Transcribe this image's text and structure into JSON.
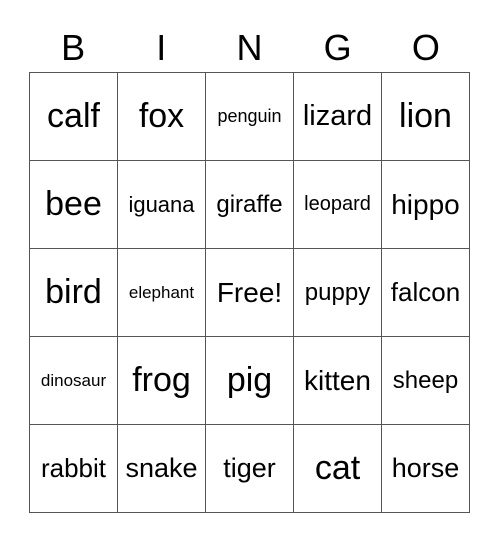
{
  "header": [
    "B",
    "I",
    "N",
    "G",
    "O"
  ],
  "cells": [
    [
      "calf",
      "fox",
      "penguin",
      "lizard",
      "lion"
    ],
    [
      "bee",
      "iguana",
      "giraffe",
      "leopard",
      "hippo"
    ],
    [
      "bird",
      "elephant",
      "Free!",
      "puppy",
      "falcon"
    ],
    [
      "dinosaur",
      "frog",
      "pig",
      "kitten",
      "sheep"
    ],
    [
      "rabbit",
      "snake",
      "tiger",
      "cat",
      "horse"
    ]
  ]
}
